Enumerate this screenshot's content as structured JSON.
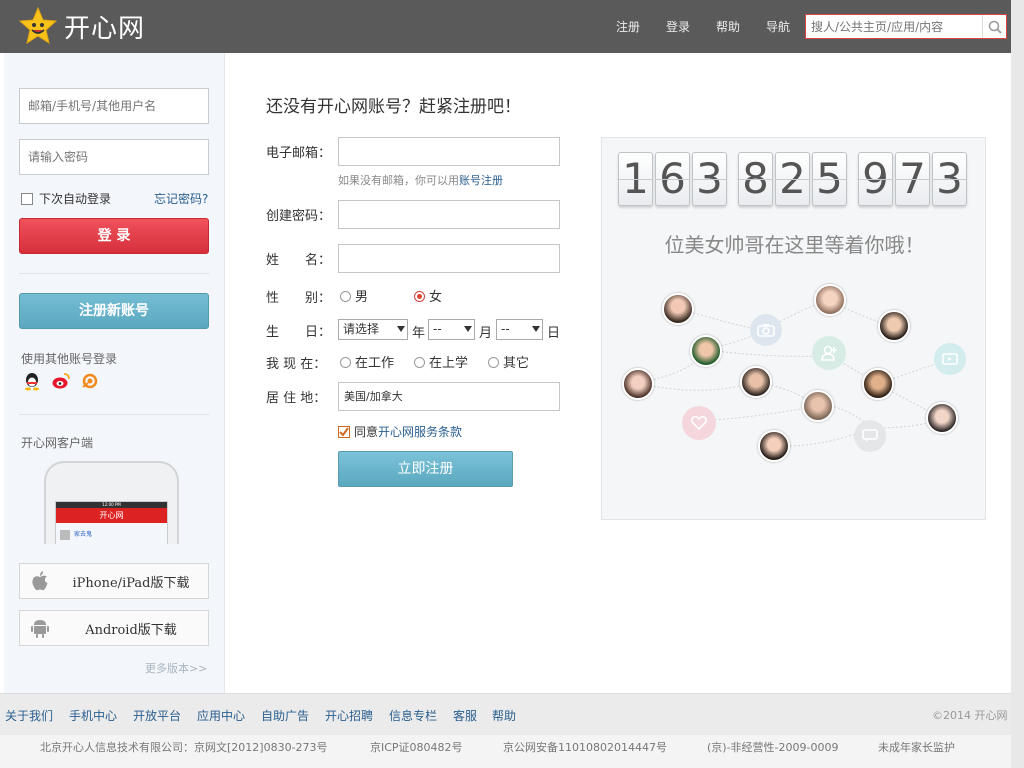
{
  "header": {
    "logo_text": "开心网",
    "nav": [
      "注册",
      "登录",
      "帮助",
      "导航"
    ],
    "search_placeholder": "搜人/公共主页/应用/内容"
  },
  "login": {
    "username_placeholder": "邮箱/手机号/其他用户名",
    "password_placeholder": "请输入密码",
    "remember_label": "下次自动登录",
    "forgot_label": "忘记密码?",
    "login_button": "登 录",
    "register_button": "注册新账号",
    "other_accounts_label": "使用其他账号登录",
    "client_label": "开心网客户端",
    "phone_title": "开心网",
    "phone_time": "12:00 PM",
    "phone_list_item": "家去鬼",
    "iphone_download": "iPhone/iPad版下载",
    "android_download": "Android版下载",
    "more_versions": "更多版本>>"
  },
  "form": {
    "heading": "还没有开心网账号？赶紧注册吧！",
    "email_label": "电子邮箱：",
    "email_hint": "如果没有邮箱，你可以用",
    "email_hint_link": "账号注册",
    "password_label": "创建密码：",
    "name_label": "姓　　名：",
    "gender_label": "性　　别：",
    "gender_male": "男",
    "gender_female": "女",
    "birthday_label": "生　　日：",
    "birthday_select": "请选择",
    "year_unit": "年",
    "month_unit": "月",
    "day_unit": "日",
    "dash": "--",
    "status_label": "我 现 在：",
    "status_work": "在工作",
    "status_school": "在上学",
    "status_other": "其它",
    "residence_label": "居 住 地：",
    "residence_value": "美国/加拿大",
    "agree_prefix": "同意",
    "agree_link": "开心网服务条款",
    "submit": "立即注册"
  },
  "promo": {
    "digits": [
      "1",
      "6",
      "3",
      "8",
      "2",
      "5",
      "9",
      "7",
      "3"
    ],
    "tagline": "位美女帅哥在这里等着你哦！"
  },
  "footer": {
    "links": [
      "关于我们",
      "手机中心",
      "开放平台",
      "应用中心",
      "自助广告",
      "开心招聘",
      "信息专栏",
      "客服",
      "帮助"
    ],
    "copyright": "©2014 开心网",
    "legal": [
      "北京开心人信息技术有限公司：京网文[2012]0830-273号",
      "京ICP证080482号",
      "京公网安备11010802014447号",
      "(京)-非经营性-2009-0009",
      "未成年家长监护"
    ]
  },
  "colors": {
    "topbar": "#5a5a5a",
    "login_red": "#e2404b",
    "register_blue": "#64b0c8",
    "link": "#2a5f8f"
  }
}
